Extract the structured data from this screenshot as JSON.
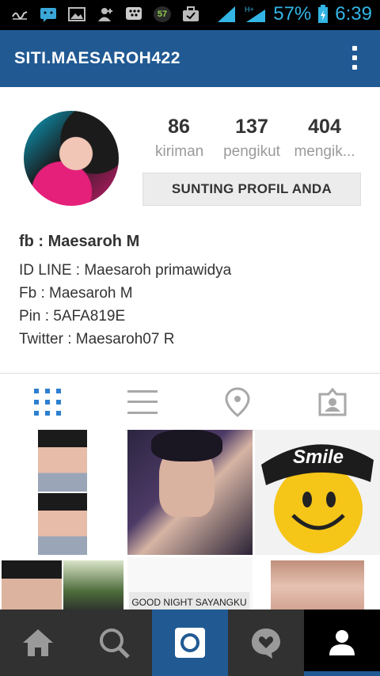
{
  "status_bar": {
    "notification_icons": [
      "signature-icon",
      "chat-icon",
      "image-icon",
      "person-add-icon",
      "bbm-icon",
      "badge-icon",
      "briefcase-icon"
    ],
    "badge_count": "57",
    "network": "H+",
    "battery": "57%",
    "time": "6:39"
  },
  "header": {
    "username": "SITI.MAESAROH422"
  },
  "stats": [
    {
      "count": "86",
      "label": "kiriman"
    },
    {
      "count": "137",
      "label": "pengikut"
    },
    {
      "count": "404",
      "label": "mengik..."
    }
  ],
  "edit_profile_label": "SUNTING PROFIL ANDA",
  "bio": {
    "name": "fb : Maesaroh M",
    "lines": [
      "ID LINE : Maesaroh primawidya",
      "Fb : Maesaroh M",
      "Pin : 5AFA819E",
      "Twitter : Maesaroh07 R"
    ]
  },
  "tabs": [
    "grid-icon",
    "list-icon",
    "location-pin-icon",
    "tagged-photos-icon"
  ],
  "posts": {
    "smile_caption": "Smile",
    "goodnight_caption": "GOOD NIGHT SAYANGKU"
  },
  "bottom_nav": [
    "home-icon",
    "search-icon",
    "camera-icon",
    "activity-icon",
    "profile-icon"
  ],
  "colors": {
    "brand_blue": "#215a93",
    "status_blue": "#33b5e5",
    "nav_bg": "#313131"
  }
}
